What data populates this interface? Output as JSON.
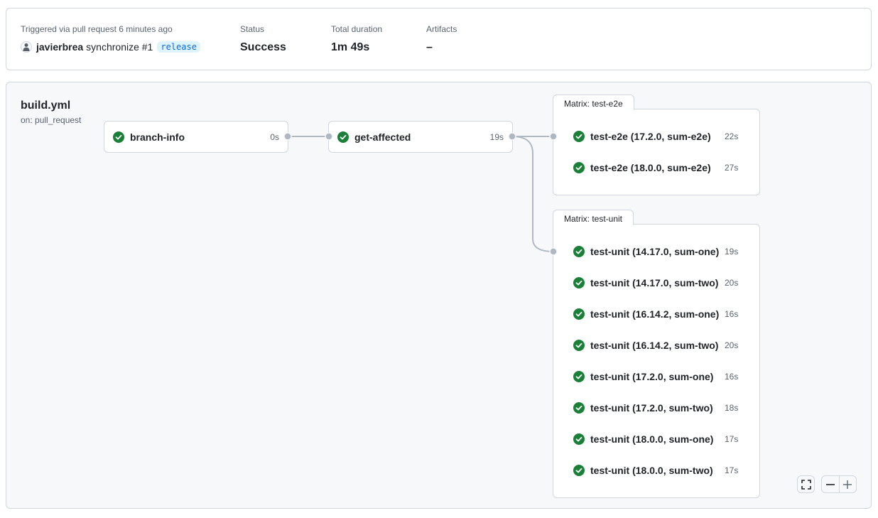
{
  "summary": {
    "triggered_label": "Triggered via pull request 6 minutes ago",
    "actor": "javierbrea",
    "event": "synchronize #1",
    "branch": "release",
    "status_label": "Status",
    "status_value": "Success",
    "duration_label": "Total duration",
    "duration_value": "1m 49s",
    "artifacts_label": "Artifacts",
    "artifacts_value": "–"
  },
  "workflow": {
    "name": "build.yml",
    "trigger": "on: pull_request"
  },
  "jobs": [
    {
      "name": "branch-info",
      "duration": "0s",
      "status": "success"
    },
    {
      "name": "get-affected",
      "duration": "19s",
      "status": "success"
    }
  ],
  "matrices": [
    {
      "label": "Matrix: test-e2e",
      "jobs": [
        {
          "name": "test-e2e (17.2.0, sum-e2e)",
          "duration": "22s",
          "status": "success"
        },
        {
          "name": "test-e2e (18.0.0, sum-e2e)",
          "duration": "27s",
          "status": "success"
        }
      ]
    },
    {
      "label": "Matrix: test-unit",
      "jobs": [
        {
          "name": "test-unit (14.17.0, sum-one)",
          "duration": "19s",
          "status": "success"
        },
        {
          "name": "test-unit (14.17.0, sum-two)",
          "duration": "20s",
          "status": "success"
        },
        {
          "name": "test-unit (16.14.2, sum-one)",
          "duration": "16s",
          "status": "success"
        },
        {
          "name": "test-unit (16.14.2, sum-two)",
          "duration": "20s",
          "status": "success"
        },
        {
          "name": "test-unit (17.2.0, sum-one)",
          "duration": "16s",
          "status": "success"
        },
        {
          "name": "test-unit (17.2.0, sum-two)",
          "duration": "18s",
          "status": "success"
        },
        {
          "name": "test-unit (18.0.0, sum-one)",
          "duration": "17s",
          "status": "success"
        },
        {
          "name": "test-unit (18.0.0, sum-two)",
          "duration": "17s",
          "status": "success"
        }
      ]
    }
  ],
  "colors": {
    "success": "#1a7f37",
    "accent": "#0969da",
    "border": "#d0d7de",
    "connector": "#afb8c1"
  },
  "controls": {
    "fullscreen_icon": "fullscreen-icon",
    "zoom_out_icon": "zoom-out-icon",
    "zoom_in_icon": "zoom-in-icon"
  }
}
